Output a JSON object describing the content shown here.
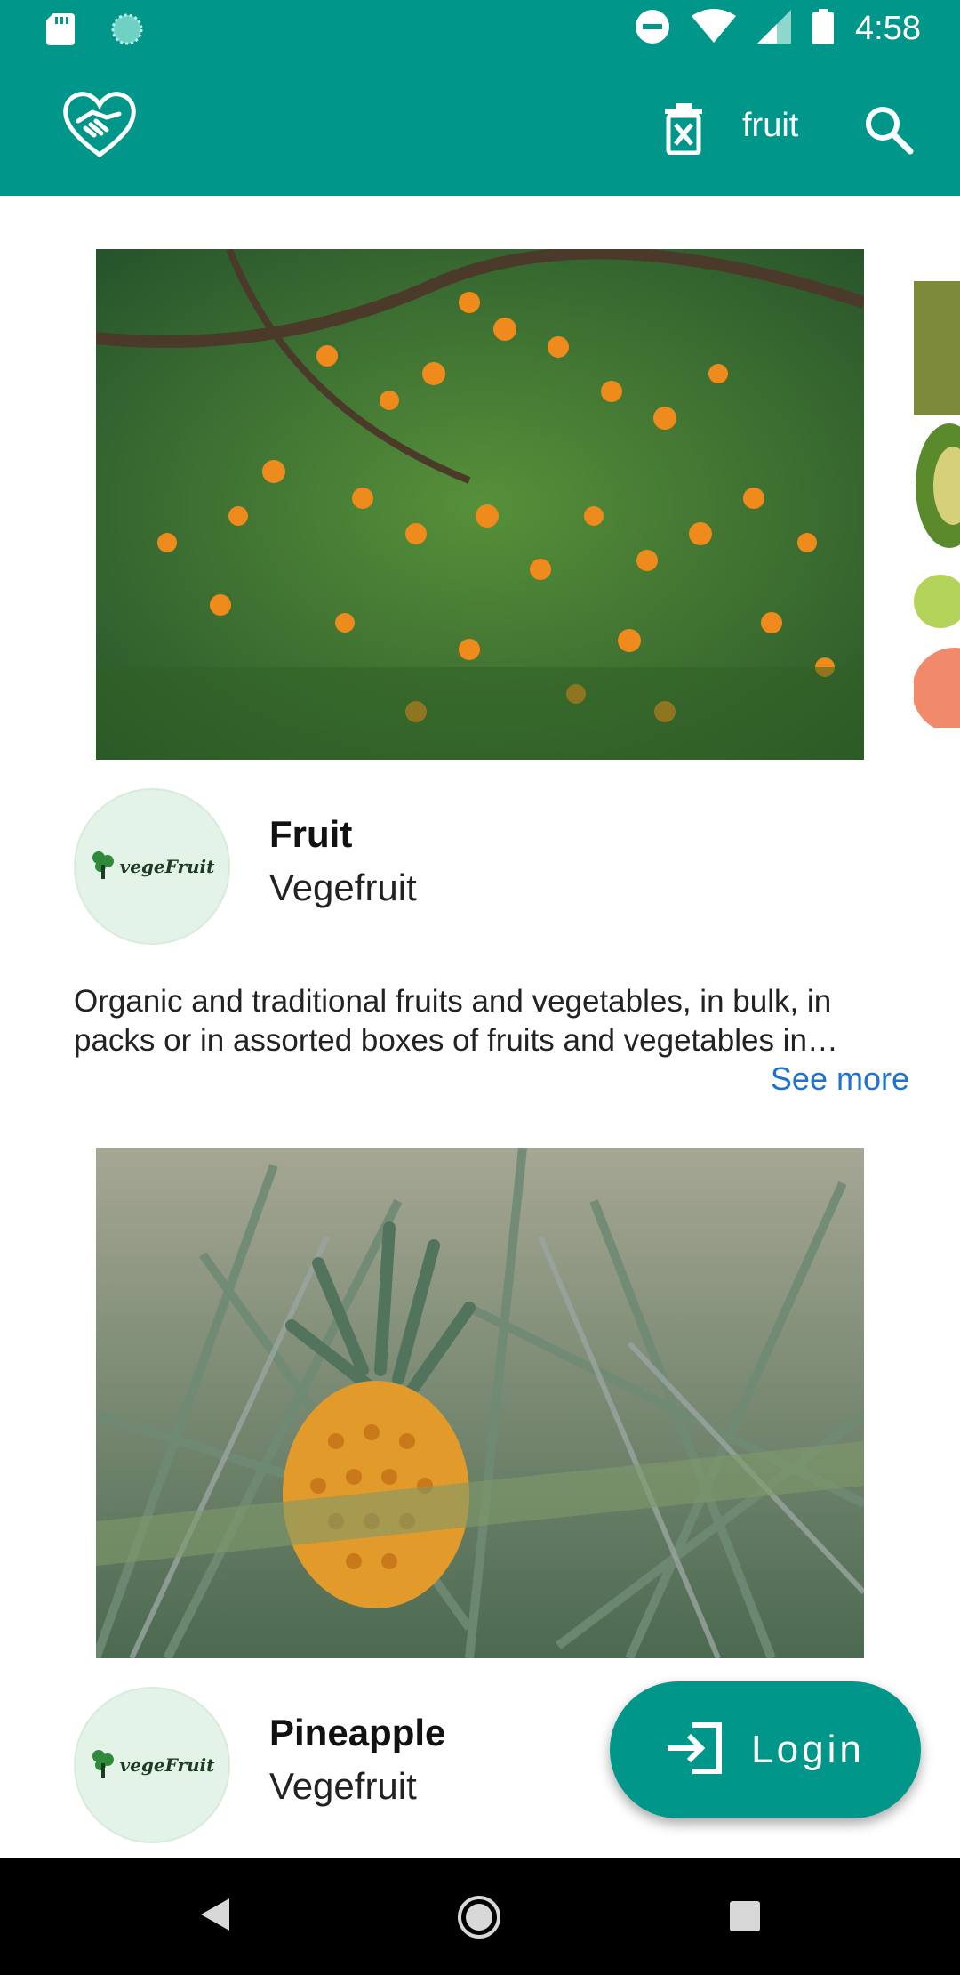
{
  "status_bar": {
    "time": "4:58",
    "icons": [
      "sd-card-icon",
      "sync-icon",
      "do-not-disturb-icon",
      "wifi-icon",
      "signal-icon",
      "battery-icon"
    ]
  },
  "app_bar": {
    "logo_icon": "handshake-heart-icon",
    "clear_filter_icon": "delete-filter-icon",
    "search_query": "fruit",
    "search_icon": "search-icon",
    "background_color": "#00978a"
  },
  "cards": [
    {
      "image_description": "fruit-tree-image",
      "title": "Fruit",
      "seller": "Vegefruit",
      "avatar_brand": "vegeFruit",
      "description": "Organic and traditional fruits and vegetables, in bulk, in packs or in assorted boxes of fruits and vegetables in various sizes. We deliver directly to your home.",
      "see_more": "See more"
    },
    {
      "image_description": "pineapple-field-image",
      "title": "Pineapple",
      "seller": "Vegefruit",
      "avatar_brand": "vegeFruit"
    }
  ],
  "fab": {
    "label": "Login",
    "icon": "login-icon"
  },
  "nav_bar": {
    "icons": [
      "back-icon",
      "home-icon",
      "recents-icon"
    ]
  },
  "colors": {
    "primary": "#00978a",
    "link": "#1e73d2",
    "avatar_bg": "#e3f3e7"
  }
}
